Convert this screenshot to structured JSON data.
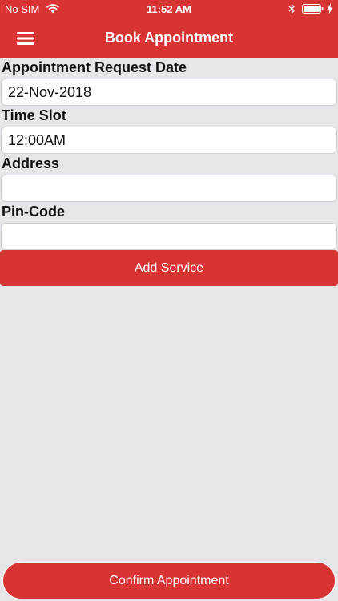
{
  "status_bar": {
    "carrier": "No SIM",
    "time": "11:52 AM",
    "wifi_icon": "wifi-icon",
    "bluetooth_icon": "bluetooth-icon",
    "battery_icon": "battery-icon",
    "charging_icon": "charging-bolt-icon",
    "battery_level": 1.0
  },
  "nav": {
    "title": "Book Appointment",
    "menu_icon": "hamburger-menu-icon"
  },
  "form": {
    "request_date": {
      "label": "Appointment Request Date",
      "value": "22-Nov-2018"
    },
    "time_slot": {
      "label": "Time Slot",
      "value": "12:00AM"
    },
    "address": {
      "label": "Address",
      "value": ""
    },
    "pin_code": {
      "label": "Pin-Code",
      "value": ""
    },
    "add_service_label": "Add Service"
  },
  "footer": {
    "confirm_label": "Confirm Appointment"
  },
  "colors": {
    "brand_red": "#d93434",
    "background": "#e5e5ea",
    "input_background": "#ffffff"
  }
}
